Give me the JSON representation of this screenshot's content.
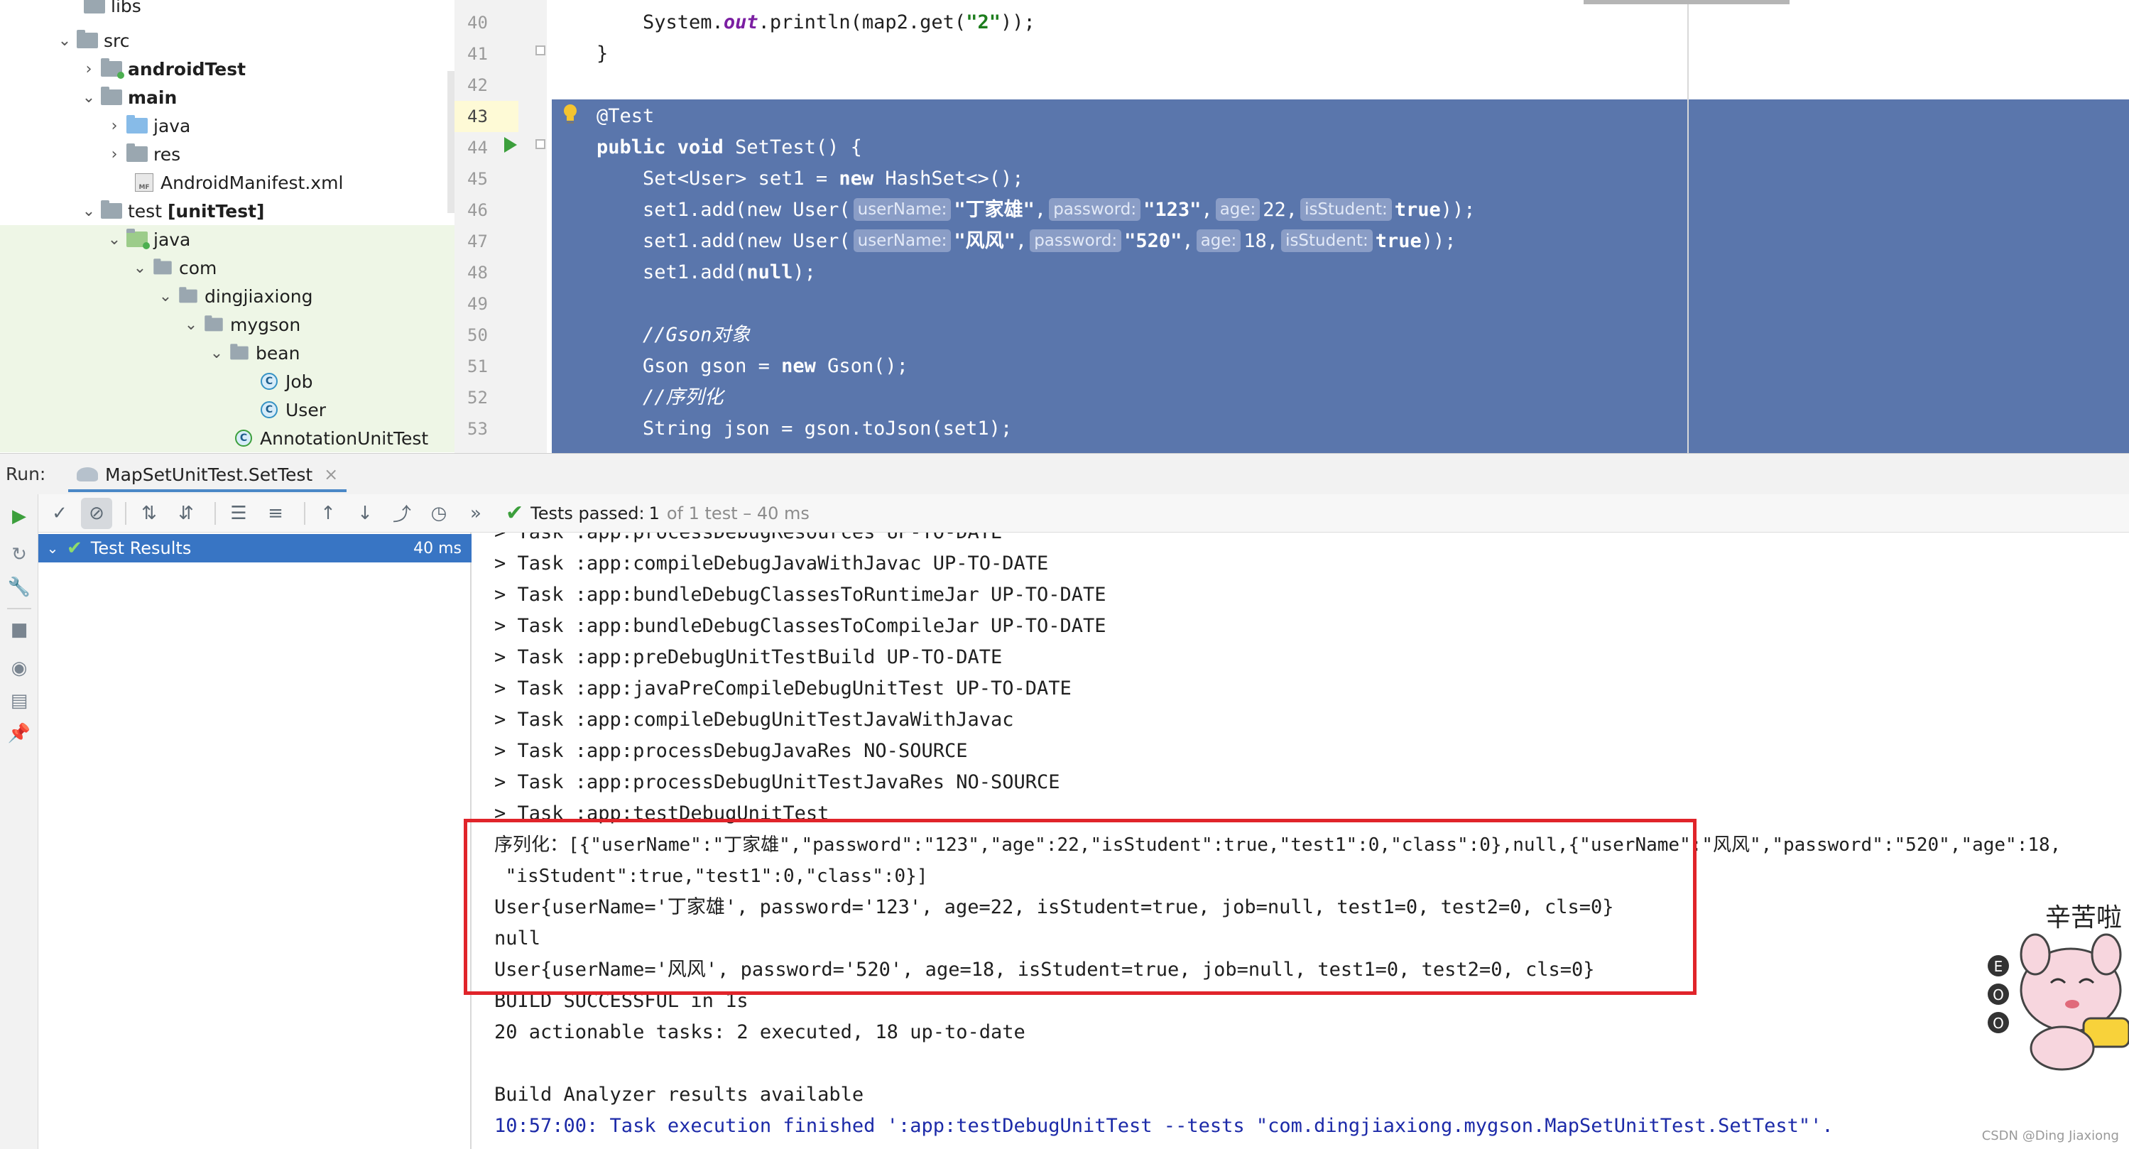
{
  "project_tree": {
    "items": [
      {
        "label": "libs",
        "icon": "folder-icon",
        "chevron": "",
        "bold": false
      },
      {
        "label": "src",
        "icon": "folder-icon",
        "chevron": "down",
        "bold": false
      },
      {
        "label": "androidTest",
        "icon": "folder-icon",
        "chevron": "right",
        "bold": true
      },
      {
        "label": "main",
        "icon": "folder-icon",
        "chevron": "down",
        "bold": true
      },
      {
        "label": "java",
        "icon": "source-folder-icon",
        "chevron": "right",
        "bold": false
      },
      {
        "label": "res",
        "icon": "resource-folder-icon",
        "chevron": "right",
        "bold": false
      },
      {
        "label": "AndroidManifest.xml",
        "icon": "manifest-file-icon",
        "chevron": "",
        "bold": false
      },
      {
        "label": "test [unitTest]",
        "icon": "folder-icon",
        "chevron": "down",
        "bold": false
      },
      {
        "label": "java",
        "icon": "test-source-folder-icon",
        "chevron": "down",
        "bold": false
      },
      {
        "label": "com",
        "icon": "package-icon",
        "chevron": "down",
        "bold": false
      },
      {
        "label": "dingjiaxiong",
        "icon": "package-icon",
        "chevron": "down",
        "bold": false
      },
      {
        "label": "mygson",
        "icon": "package-icon",
        "chevron": "down",
        "bold": false
      },
      {
        "label": "bean",
        "icon": "package-icon",
        "chevron": "down",
        "bold": false
      },
      {
        "label": "Job",
        "icon": "class-icon",
        "chevron": "",
        "bold": false
      },
      {
        "label": "User",
        "icon": "class-icon",
        "chevron": "",
        "bold": false
      },
      {
        "label": "AnnotationUnitTest",
        "icon": "test-class-icon",
        "chevron": "",
        "bold": false
      }
    ],
    "test_bold_part": "[unitTest]"
  },
  "editor": {
    "line_numbers": [
      "40",
      "41",
      "42",
      "43",
      "44",
      "45",
      "46",
      "47",
      "48",
      "49",
      "50",
      "51",
      "52",
      "53"
    ],
    "current_line": "43",
    "lines": {
      "l40": {
        "pre": "    System.",
        "field": "out",
        "post": ".println(map2.get(",
        "str": "\"2\"",
        "end": "));"
      },
      "l41": "}",
      "l43": "@Test",
      "l44": {
        "kw1": "public void",
        "rest": " SetTest() {"
      },
      "l45": {
        "pre": "    Set<User> set1 = ",
        "kw": "new",
        "post": " HashSet<>();"
      },
      "l46": {
        "pre": "    set1.add(new User(",
        "h1": "userName:",
        "v1": "\"丁家雄\"",
        "h2": "password:",
        "v2": "\"123\"",
        "h3": "age:",
        "v3": "22",
        "h4": "isStudent:",
        "v4": "true",
        "end": "));"
      },
      "l47": {
        "pre": "    set1.add(new User(",
        "h1": "userName:",
        "v1": "\"风风\"",
        "h2": "password:",
        "v2": "\"520\"",
        "h3": "age:",
        "v3": "18",
        "h4": "isStudent:",
        "v4": "true",
        "end": "));"
      },
      "l48": {
        "pre": "    set1.add(",
        "kw": "null",
        "end": ");"
      },
      "l50": "    //Gson对象",
      "l51": {
        "pre": "    Gson gson = ",
        "kw": "new",
        "post": " Gson();"
      },
      "l52": "    //序列化",
      "l53": "    String json = gson.toJson(set1);"
    }
  },
  "run_panel": {
    "label": "Run:",
    "tab_title": "MapSetUnitTest.SetTest",
    "tab_close": "×",
    "status": {
      "check": "✔",
      "prefix": "Tests passed:",
      "count": "1",
      "suffix": "of 1 test – 40 ms"
    },
    "results": {
      "label": "Test Results",
      "time": "40 ms"
    },
    "console_lines": [
      "> Task :app:processDebugResources UP-TO-DATE",
      "> Task :app:compileDebugJavaWithJavac UP-TO-DATE",
      "> Task :app:bundleDebugClassesToRuntimeJar UP-TO-DATE",
      "> Task :app:bundleDebugClassesToCompileJar UP-TO-DATE",
      "> Task :app:preDebugUnitTestBuild UP-TO-DATE",
      "> Task :app:javaPreCompileDebugUnitTest UP-TO-DATE",
      "> Task :app:compileDebugUnitTestJavaWithJavac",
      "> Task :app:processDebugJavaRes NO-SOURCE",
      "> Task :app:processDebugUnitTestJavaRes NO-SOURCE",
      "> Task :app:testDebugUnitTest",
      "序列化：[{\"userName\":\"丁家雄\",\"password\":\"123\",\"age\":22,\"isStudent\":true,\"test1\":0,\"class\":0},null,{\"userName\":\"风风\",\"password\":\"520\",\"age\":18,",
      " \"isStudent\":true,\"test1\":0,\"class\":0}]",
      "User{userName='丁家雄', password='123', age=22, isStudent=true, job=null, test1=0, test2=0, cls=0}",
      "null",
      "User{userName='风风', password='520', age=18, isStudent=true, job=null, test1=0, test2=0, cls=0}",
      "BUILD SUCCESSFUL in 1s",
      "20 actionable tasks: 2 executed, 18 up-to-date",
      "",
      "Build Analyzer results available",
      "10:57:00: Task execution finished ':app:testDebugUnitTest --tests \"com.dingjiaxiong.mygson.MapSetUnitTest.SetTest\"'."
    ]
  },
  "sticker": {
    "text": "辛苦啦",
    "badge": [
      "E",
      "O",
      "O"
    ]
  },
  "watermark": "CSDN @Ding Jiaxiong",
  "colors": {
    "selection": "#5a76ac",
    "results_row": "#3875c4",
    "highlight_box": "#e0242a",
    "pass_green": "#3c9f3c",
    "console_link": "#1c2aa8"
  }
}
